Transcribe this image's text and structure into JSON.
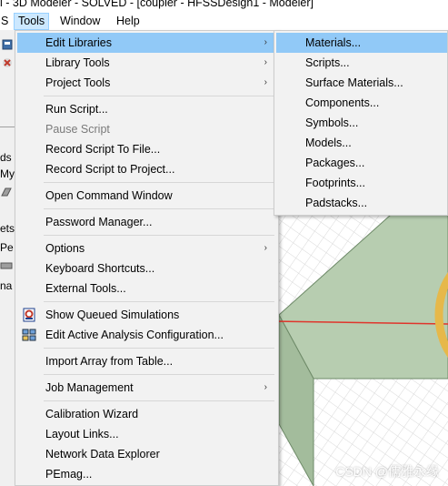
{
  "window": {
    "title": "l - 3D Modeler - SOLVED - [coupler - HFSSDesign1 - Modeler]"
  },
  "menubar": {
    "items": [
      {
        "label": "S"
      },
      {
        "label": "Tools"
      },
      {
        "label": "Window"
      },
      {
        "label": "Help"
      }
    ]
  },
  "left_fragments": [
    "ds",
    "My",
    "ets",
    "Pe",
    "na"
  ],
  "tools_menu": {
    "items": [
      {
        "label": "Edit Libraries",
        "submenu": true,
        "highlighted": true
      },
      {
        "label": "Library Tools",
        "submenu": true
      },
      {
        "label": "Project Tools",
        "submenu": true
      },
      {
        "label": "Run Script..."
      },
      {
        "label": "Pause Script",
        "disabled": true
      },
      {
        "label": "Record Script To File..."
      },
      {
        "label": "Record Script to Project..."
      },
      {
        "label": "Open Command Window"
      },
      {
        "label": "Password Manager..."
      },
      {
        "label": "Options",
        "submenu": true
      },
      {
        "label": "Keyboard Shortcuts..."
      },
      {
        "label": "External Tools..."
      },
      {
        "label": "Show Queued Simulations",
        "icon": "queue-icon"
      },
      {
        "label": "Edit Active Analysis Configuration...",
        "icon": "analysis-config-icon"
      },
      {
        "label": "Import Array from Table..."
      },
      {
        "label": "Job Management",
        "submenu": true
      },
      {
        "label": "Calibration Wizard"
      },
      {
        "label": "Layout Links..."
      },
      {
        "label": "Network Data Explorer"
      },
      {
        "label": "PEmag..."
      }
    ],
    "arrow_glyph": "›"
  },
  "edit_libraries_submenu": {
    "items": [
      {
        "label": "Materials...",
        "highlighted": true
      },
      {
        "label": "Scripts..."
      },
      {
        "label": "Surface Materials..."
      },
      {
        "label": "Components..."
      },
      {
        "label": "Symbols..."
      },
      {
        "label": "Models..."
      },
      {
        "label": "Packages..."
      },
      {
        "label": "Footprints..."
      },
      {
        "label": "Padstacks..."
      }
    ]
  },
  "watermark": "CSDN @儒雅永缘",
  "colors": {
    "highlight": "#91c9f7",
    "menu_bg": "#f2f2f2",
    "model_fill": "#b7cdb0",
    "ring": "#e6b84a",
    "axis_line": "#e0342b"
  }
}
